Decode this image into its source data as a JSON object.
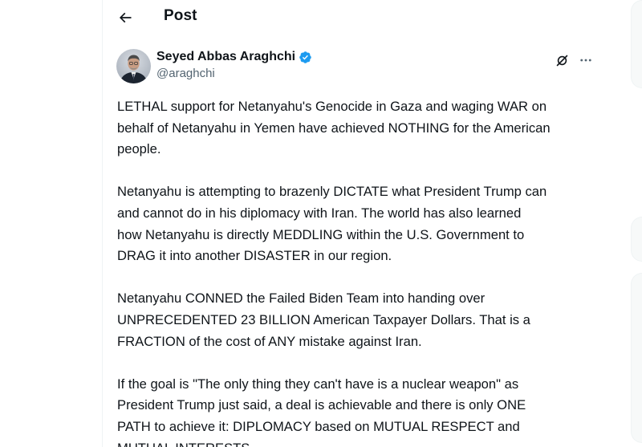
{
  "header": {
    "title": "Post",
    "back_icon": "arrow-left-icon"
  },
  "author": {
    "display_name": "Seyed Abbas Araghchi",
    "handle": "@araghchi",
    "verified_icon": "verified-badge-icon",
    "verified_color": "#1d9bf0"
  },
  "actions": {
    "grok_icon": "grok-icon",
    "more_icon": "more-horizontal-icon"
  },
  "post": {
    "paragraphs": [
      {
        "lines": [
          "LETHAL support for Netanyahu's Genocide in Gaza and waging WAR on",
          "behalf of Netanyahu in Yemen have achieved NOTHING for the American",
          "people."
        ]
      },
      {
        "lines": [
          "Netanyahu is attempting to brazenly DICTATE what President Trump can",
          "and cannot do in his diplomacy with Iran. The world has also learned",
          "how Netanyahu is directly MEDDLING within the U.S. Government to",
          "DRAG it into another DISASTER in our region."
        ]
      },
      {
        "lines": [
          "Netanyahu CONNED the Failed Biden Team into handing over",
          "UNPRECEDENTED 23 BILLION American Taxpayer Dollars. That is a",
          "FRACTION of the cost of ANY mistake against Iran."
        ]
      },
      {
        "lines": [
          "If the goal is \"The only thing they can't have is a nuclear weapon\" as",
          "President Trump just said, a deal is achievable and there is only ONE",
          "PATH to achieve it: DIPLOMACY based on MUTUAL RESPECT and",
          "MUTUAL INTERESTS."
        ]
      }
    ]
  },
  "colors": {
    "text_primary": "#0f1419",
    "text_secondary": "#536471",
    "border": "#eff3f4",
    "accent": "#1d9bf0"
  }
}
